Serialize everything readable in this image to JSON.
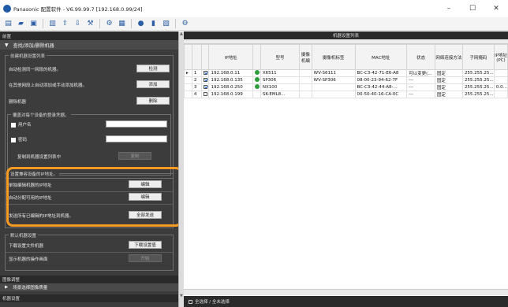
{
  "window": {
    "title": "Panasonic 配置软件 - V6.99.99.7 [192.168.0.99/24]",
    "min": "–",
    "max": "☐",
    "close": "✕"
  },
  "left": {
    "header": "前置",
    "nav_title": "查找/添加/删除机器",
    "group1": {
      "title": "创建机器设置列表",
      "rows": [
        {
          "label": "自动检测同一网段的机器。",
          "button": "检测"
        },
        {
          "label": "在其他网段上自动添加或手动添加机器。",
          "button": "添加"
        },
        {
          "label": "删除机器",
          "button": "删除"
        }
      ],
      "cred_title": "覆盖对每个设备的登录凭据。",
      "username": "用户名",
      "password": "密码",
      "copy_label": "复制到机器设置列表中",
      "copy_button": "复制"
    },
    "group2": {
      "title": "设置兼容设备的IP地址。",
      "rows": [
        {
          "label": "单独编辑机器的IP地址",
          "button": "编辑"
        },
        {
          "label": "自动分配可用的IP地址",
          "button": "编辑"
        },
        {
          "label": "发送所有已编辑的IP地址到机器。",
          "button": "全部发送"
        }
      ]
    },
    "group3": {
      "title": "默认机器设置",
      "rows": [
        {
          "label": "下载设置文件机器",
          "button": "下载设置值"
        },
        {
          "label": "显示机器的操作画面",
          "button": "开始"
        }
      ]
    },
    "section_image": "图像调整",
    "section_image_sub": "场景选择图像质量",
    "section_bottom": "机器设置"
  },
  "right": {
    "title": "机器设置列表",
    "columns": [
      "",
      "",
      "",
      "IP地址",
      "",
      "型号",
      "摄像机编",
      "摄像机标签",
      "MAC地址",
      "状态",
      "网络连接方法",
      "子网掩码",
      "IP地址(PC)"
    ],
    "rows": [
      {
        "arrow": "▸",
        "no": "1",
        "checked": true,
        "ip": "192.168.0.11",
        "ok": true,
        "model": "X6511",
        "label": "WV-S6111",
        "mac": "BC-C3-42-71-E6-A8",
        "status": "可以变更(...",
        "method": "固定",
        "mask": "255.255.25...",
        "gw": ""
      },
      {
        "arrow": "",
        "no": "2",
        "checked": true,
        "ip": "192.168.0.135",
        "ok": true,
        "model": "SP306",
        "label": "WV-SP306",
        "mac": "08-00-23-94-62-7F",
        "status": "---",
        "method": "固定",
        "mask": "255.255.25...",
        "gw": ""
      },
      {
        "arrow": "",
        "no": "3",
        "checked": true,
        "ip": "192.168.0.250",
        "ok": true,
        "model": "NX100",
        "label": "",
        "mac": "BC-C3-42-44-A8-...",
        "status": "---",
        "method": "固定",
        "mask": "255.255.25...",
        "gw": "0.0..."
      },
      {
        "arrow": "",
        "no": "4",
        "checked": false,
        "ip": "192.168.0.199",
        "ok": false,
        "model": "SK-EML8...",
        "label": "",
        "mac": "00-50-40-16-CA-0C",
        "status": "---",
        "method": "固定",
        "mask": "255.255.25...",
        "gw": ""
      }
    ],
    "status_label": "全选择 / 全未选择"
  }
}
